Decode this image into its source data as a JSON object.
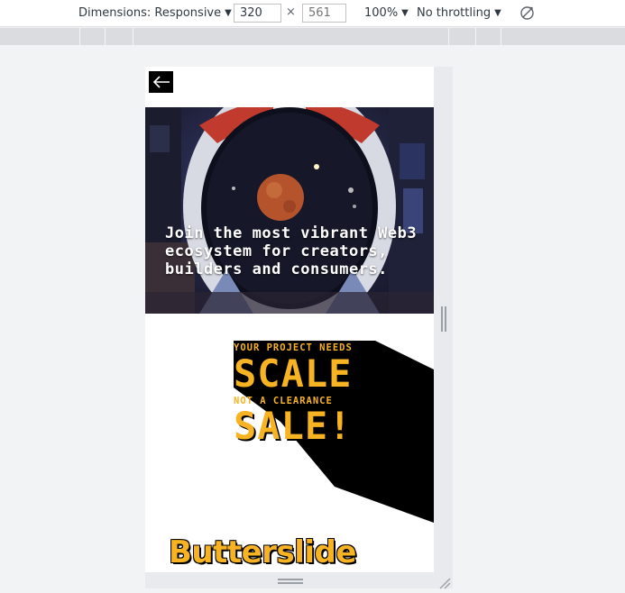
{
  "devtools": {
    "dimensions_label": "Dimensions: Responsive",
    "width_value": "320",
    "times": "×",
    "height_placeholder": "561",
    "zoom_label": "100%",
    "throttling_label": "No throttling",
    "caret": "▼"
  },
  "page": {
    "hero_text": "Join the most vibrant Web3 ecosystem for creators, builders and consumers.",
    "promo": {
      "line1": "YOUR PROJECT NEEDS",
      "line2": "SCALE",
      "line3": "NOT A CLEARANCE",
      "line4": "SALE!"
    },
    "brand": "Butterslide"
  },
  "colors": {
    "accent_yellow": "#f7b322",
    "black": "#000000"
  },
  "icons": [
    "back-arrow-icon",
    "rotate-icon",
    "resize-handle-icon"
  ]
}
